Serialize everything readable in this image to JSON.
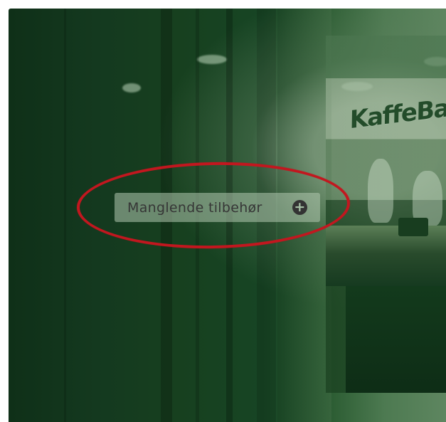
{
  "scene": {
    "background_colors": [
      "#0f3018",
      "#174524",
      "#5e8660"
    ],
    "shop_sign": "KaffeBar"
  },
  "overlay": {
    "missing_accessories_label": "Manglende tilbehør",
    "plus_icon": "plus-circle-icon",
    "highlight_color": "#c2171f"
  }
}
